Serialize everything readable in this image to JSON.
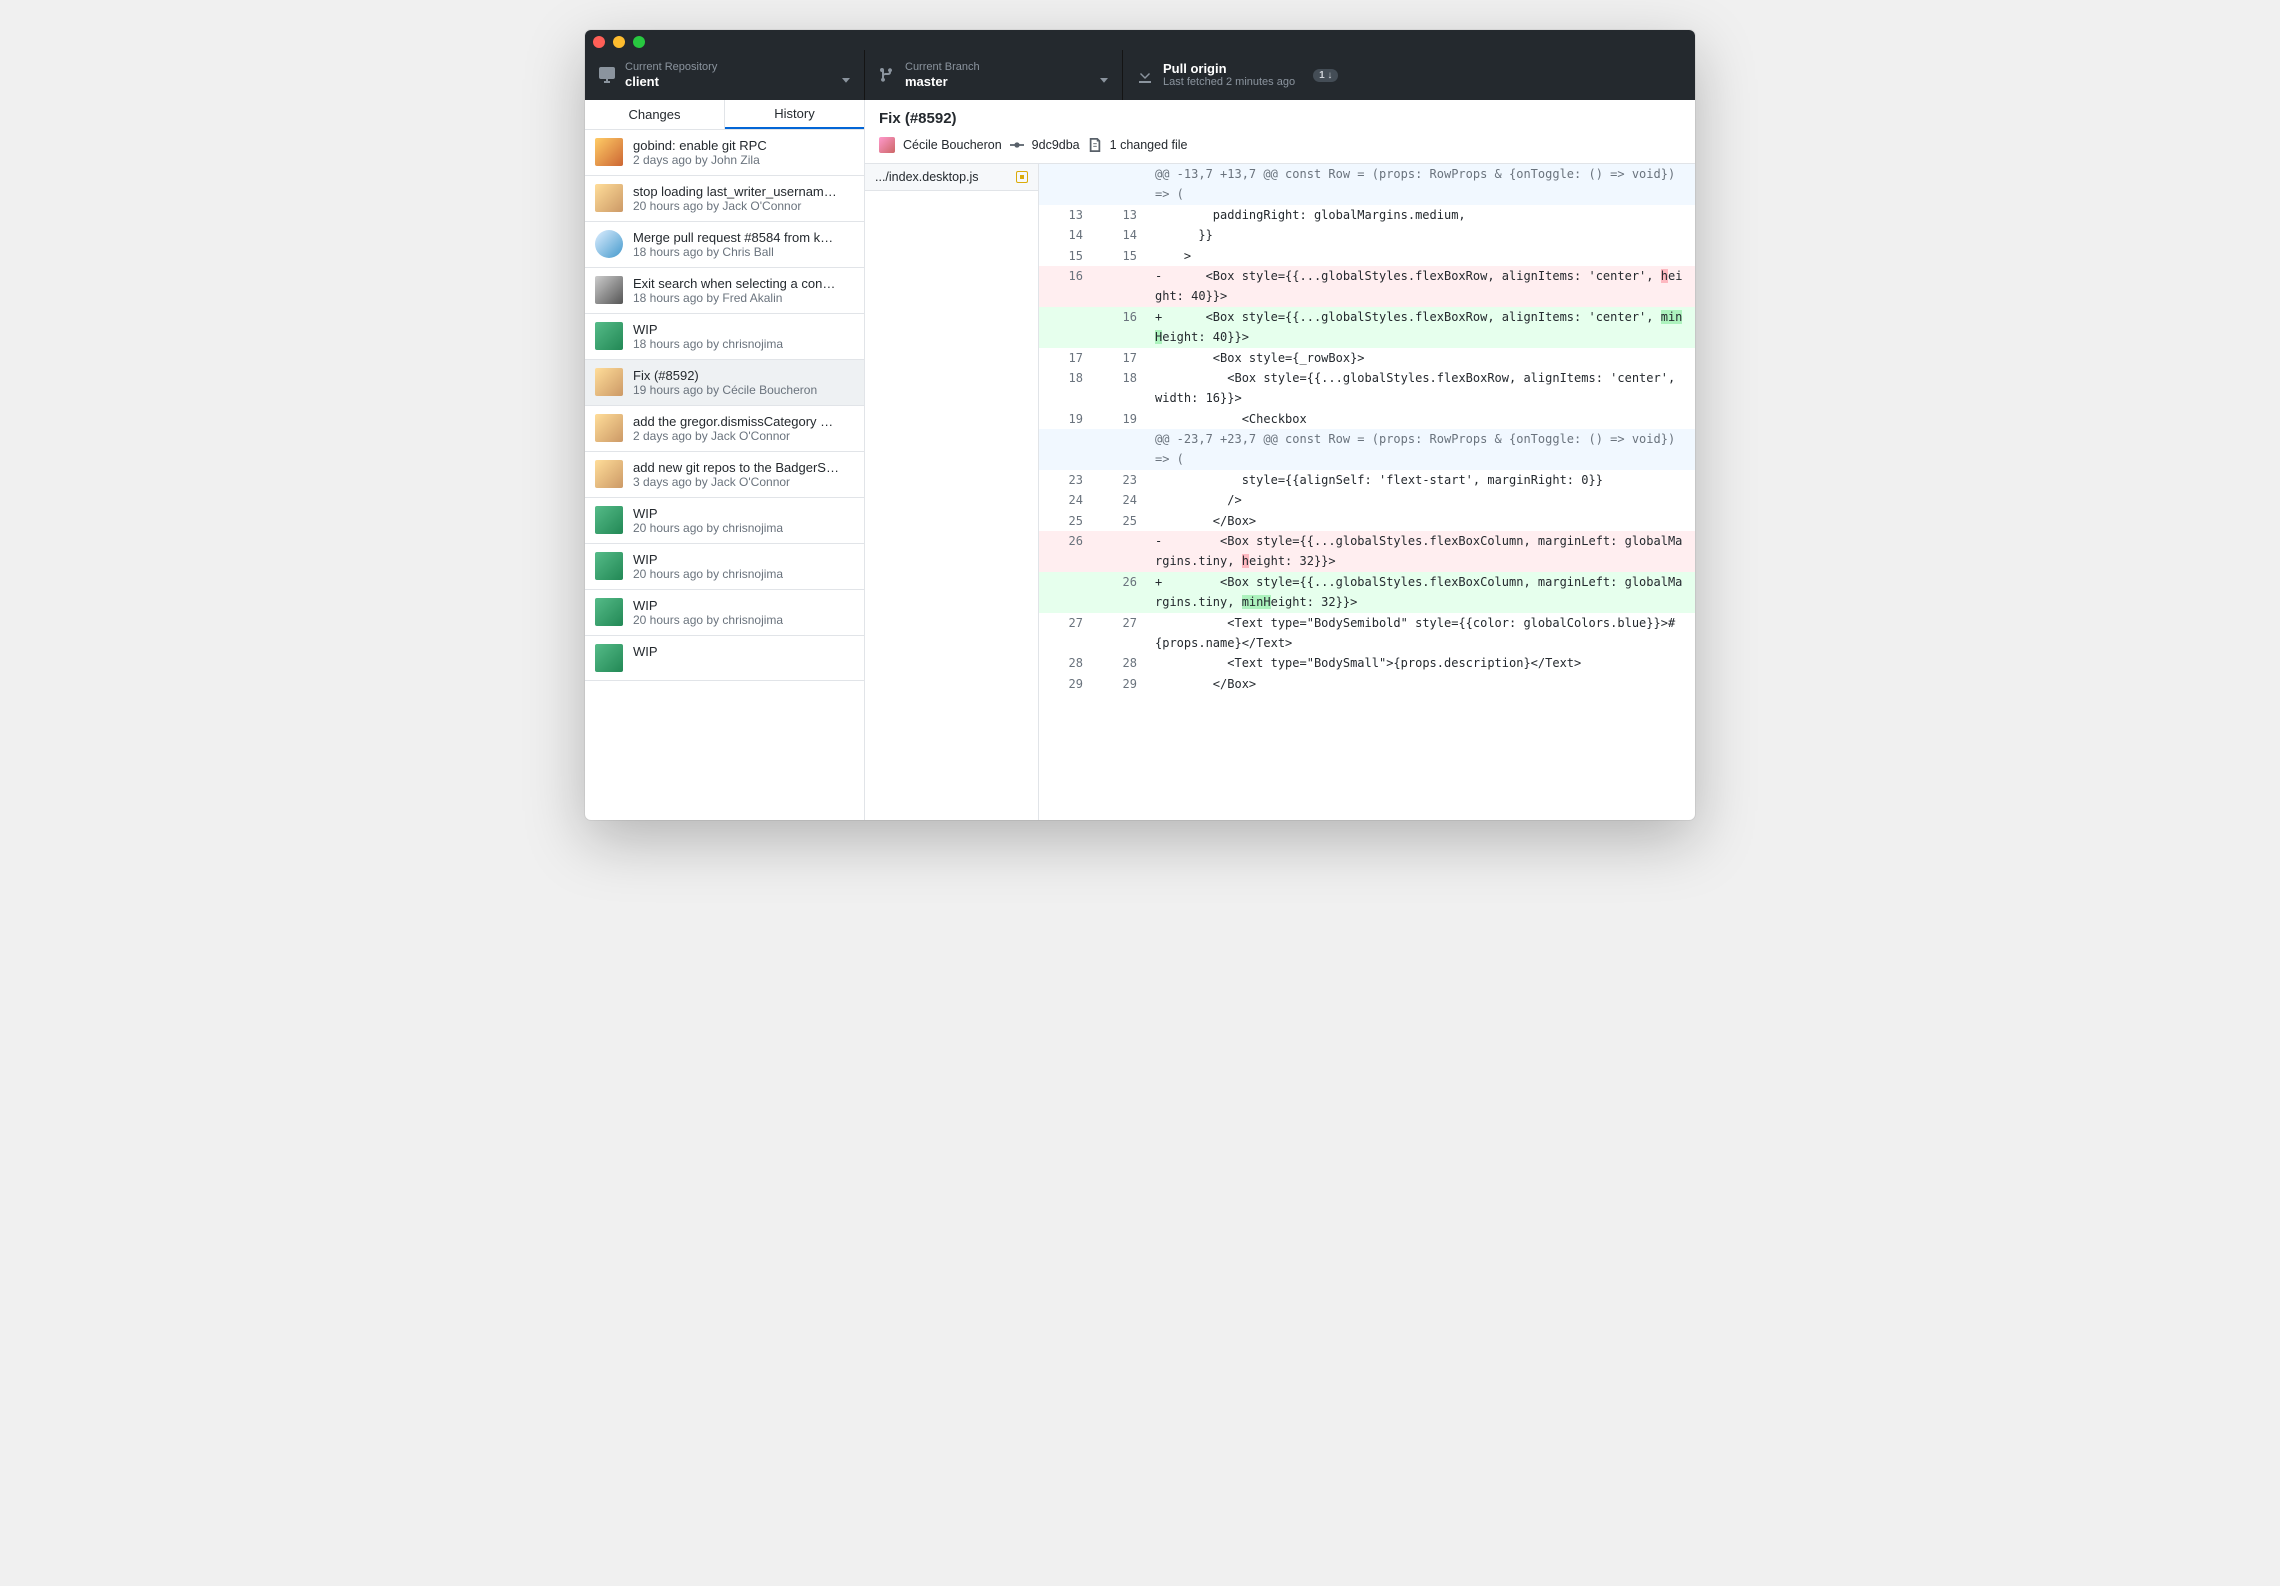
{
  "toolbar": {
    "repo": {
      "label": "Current Repository",
      "value": "client"
    },
    "branch": {
      "label": "Current Branch",
      "value": "master"
    },
    "fetch": {
      "label": "Pull origin",
      "value": "Last fetched 2 minutes ago",
      "badge": "1 ↓"
    }
  },
  "tabs": {
    "changes": "Changes",
    "history": "History"
  },
  "commits": [
    {
      "title": "gobind: enable git RPC",
      "meta": "2 days ago by John Zila"
    },
    {
      "title": "stop loading last_writer_usernam…",
      "meta": "20 hours ago by Jack O'Connor"
    },
    {
      "title": "Merge pull request #8584 from k…",
      "meta": "18 hours ago by Chris Ball"
    },
    {
      "title": "Exit search when selecting a con…",
      "meta": "18 hours ago by Fred Akalin"
    },
    {
      "title": "WIP",
      "meta": "18 hours ago by chrisnojima"
    },
    {
      "title": "Fix (#8592)",
      "meta": "19 hours ago by Cécile Boucheron"
    },
    {
      "title": "add the gregor.dismissCategory …",
      "meta": "2 days ago by Jack O'Connor"
    },
    {
      "title": "add new git repos to the BadgerS…",
      "meta": "3 days ago by Jack O'Connor"
    },
    {
      "title": "WIP",
      "meta": "20 hours ago by chrisnojima"
    },
    {
      "title": "WIP",
      "meta": "20 hours ago by chrisnojima"
    },
    {
      "title": "WIP",
      "meta": "20 hours ago by chrisnojima"
    },
    {
      "title": "WIP",
      "meta": ""
    }
  ],
  "selected_commit_index": 5,
  "detail": {
    "title": "Fix (#8592)",
    "author": "Cécile Boucheron",
    "sha": "9dc9dba",
    "files_changed_label": "1 changed file",
    "file": ".../index.desktop.js"
  },
  "diff": [
    {
      "type": "hunk",
      "old": "",
      "new": "",
      "text": "@@ -13,7 +13,7 @@ const Row = (props: RowProps & {onToggle: () => void}) => ("
    },
    {
      "type": "ctx",
      "old": "13",
      "new": "13",
      "text": "        paddingRight: globalMargins.medium,"
    },
    {
      "type": "ctx",
      "old": "14",
      "new": "14",
      "text": "      }}"
    },
    {
      "type": "ctx",
      "old": "15",
      "new": "15",
      "text": "    >"
    },
    {
      "type": "del",
      "old": "16",
      "new": "",
      "text": "-      <Box style={{...globalStyles.flexBoxRow, alignItems: 'center', height: 40}}>",
      "hl": "h"
    },
    {
      "type": "add",
      "old": "",
      "new": "16",
      "text": "+      <Box style={{...globalStyles.flexBoxRow, alignItems: 'center', minHeight: 40}}>",
      "hl": "minH"
    },
    {
      "type": "ctx",
      "old": "17",
      "new": "17",
      "text": "        <Box style={_rowBox}>"
    },
    {
      "type": "ctx",
      "old": "18",
      "new": "18",
      "text": "          <Box style={{...globalStyles.flexBoxRow, alignItems: 'center', width: 16}}>"
    },
    {
      "type": "ctx",
      "old": "19",
      "new": "19",
      "text": "            <Checkbox"
    },
    {
      "type": "hunk",
      "old": "",
      "new": "",
      "text": "@@ -23,7 +23,7 @@ const Row = (props: RowProps & {onToggle: () => void}) => ("
    },
    {
      "type": "ctx",
      "old": "23",
      "new": "23",
      "text": "            style={{alignSelf: 'flext-start', marginRight: 0}}"
    },
    {
      "type": "ctx",
      "old": "24",
      "new": "24",
      "text": "          />"
    },
    {
      "type": "ctx",
      "old": "25",
      "new": "25",
      "text": "        </Box>"
    },
    {
      "type": "del",
      "old": "26",
      "new": "",
      "text": "-        <Box style={{...globalStyles.flexBoxColumn, marginLeft: globalMargins.tiny, height: 32}}>",
      "hl": "h"
    },
    {
      "type": "add",
      "old": "",
      "new": "26",
      "text": "+        <Box style={{...globalStyles.flexBoxColumn, marginLeft: globalMargins.tiny, minHeight: 32}}>",
      "hl": "minH"
    },
    {
      "type": "ctx",
      "old": "27",
      "new": "27",
      "text": "          <Text type=\"BodySemibold\" style={{color: globalColors.blue}}>#{props.name}</Text>"
    },
    {
      "type": "ctx",
      "old": "28",
      "new": "28",
      "text": "          <Text type=\"BodySmall\">{props.description}</Text>"
    },
    {
      "type": "ctx",
      "old": "29",
      "new": "29",
      "text": "        </Box>"
    }
  ]
}
